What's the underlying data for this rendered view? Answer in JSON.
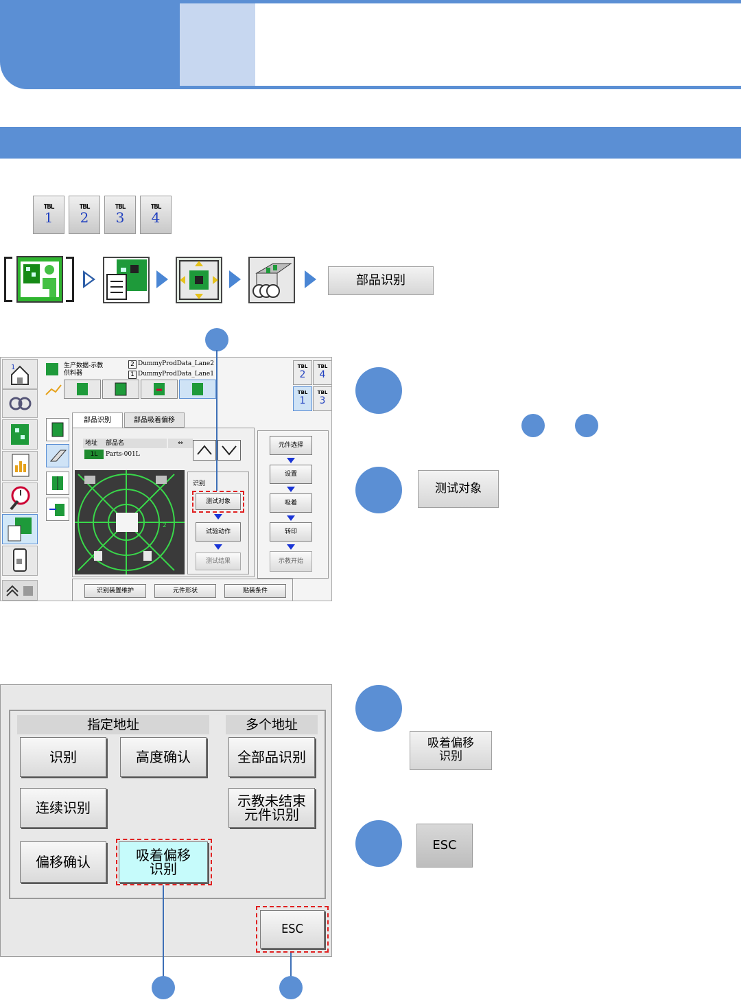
{
  "tbl_buttons": [
    {
      "label": "TBL",
      "number": "1"
    },
    {
      "label": "TBL",
      "number": "2"
    },
    {
      "label": "TBL",
      "number": "3"
    },
    {
      "label": "TBL",
      "number": "4"
    }
  ],
  "nav": {
    "final_button": "部品识别"
  },
  "shot1": {
    "header_line1": "生产数据-示教",
    "header_line2": "供料器",
    "lane2_num": "2",
    "lane2": "DummyProdData_Lane2",
    "lane1_num": "1",
    "lane1": "DummyProdData_Lane1",
    "tbl_right": [
      {
        "label": "TBL",
        "number": "2"
      },
      {
        "label": "TBL",
        "number": "4"
      },
      {
        "label": "TBL",
        "number": "1"
      },
      {
        "label": "TBL",
        "number": "3"
      }
    ],
    "tab1": "部品识别",
    "tab2": "部品吸着偏移",
    "col_addr": "地址",
    "col_name": "部品名",
    "addr_value": "1L",
    "part_value": "Parts-001L",
    "recog_label": "识别",
    "btn_test_target": "测试对象",
    "btn_test_action": "试验动作",
    "btn_test_result": "测试结果",
    "btn_component_select": "元件选择",
    "btn_setting": "设置",
    "btn_pickup": "吸着",
    "btn_transfer": "转印",
    "btn_teach_start": "示教开始",
    "btn_maintenance": "识别装置维护",
    "btn_shape": "元件形状",
    "btn_mount": "贴装条件",
    "grid_number": "2"
  },
  "step_button_test_target": "测试对象",
  "shot2": {
    "group_left": "指定地址",
    "group_right": "多个地址",
    "btn_recognize": "识别",
    "btn_height": "高度确认",
    "btn_all": "全部品识别",
    "btn_continuous": "连续识别",
    "btn_unfinished_l1": "示教未结束",
    "btn_unfinished_l2": "元件识别",
    "btn_offset_confirm": "偏移确认",
    "btn_pick_offset_l1": "吸着偏移",
    "btn_pick_offset_l2": "识别",
    "btn_esc": "ESC"
  },
  "step_pick_offset_l1": "吸着偏移",
  "step_pick_offset_l2": "识别",
  "step_esc": "ESC",
  "colors": {
    "accent": "#5b8fd4",
    "accent_light": "#c7d7f0",
    "highlight": "#e02020",
    "cyan_button": "#c6fbfb"
  }
}
